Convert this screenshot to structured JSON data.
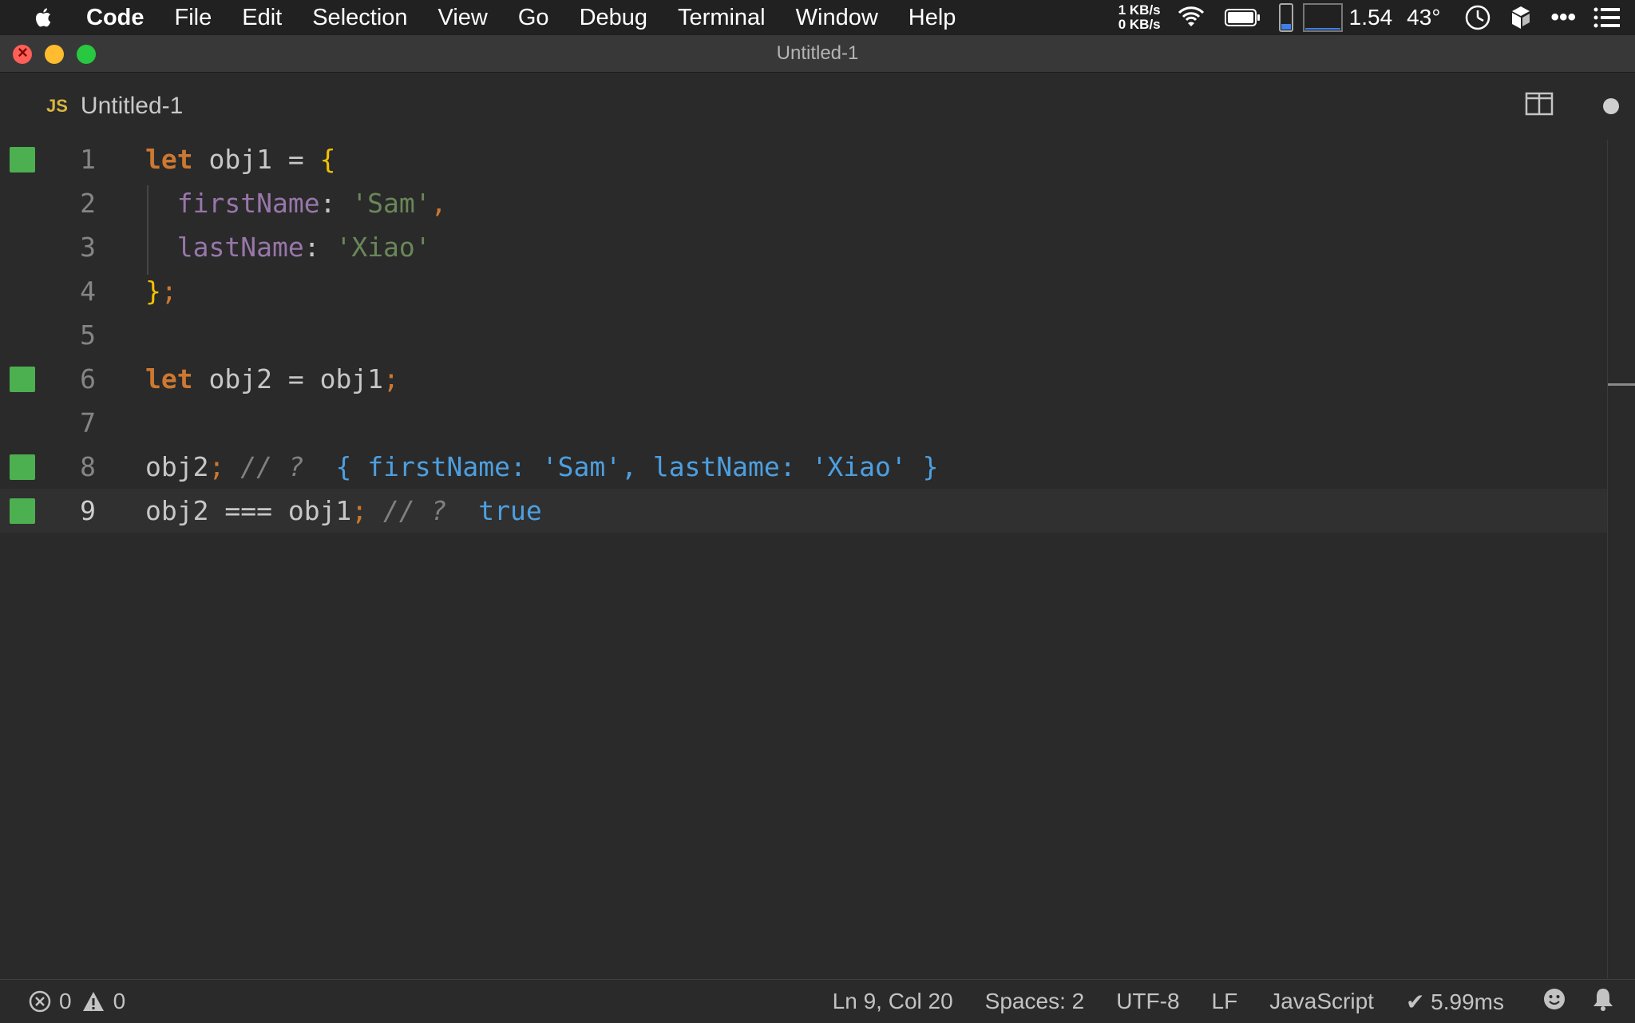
{
  "menubar": {
    "app_name": "Code",
    "items": [
      "File",
      "Edit",
      "Selection",
      "View",
      "Go",
      "Debug",
      "Terminal",
      "Window",
      "Help"
    ],
    "net_up": "1 KB/s",
    "net_down": "0 KB/s",
    "load": "1.54",
    "temp": "43°"
  },
  "window": {
    "title": "Untitled-1"
  },
  "tab": {
    "icon_text": "JS",
    "label": "Untitled-1"
  },
  "editor": {
    "line_numbers": [
      "1",
      "2",
      "3",
      "4",
      "5",
      "6",
      "7",
      "8",
      "9"
    ],
    "current_line": 9,
    "lines": [
      {
        "n": "1",
        "mark": true,
        "tokens": [
          [
            "kw",
            "let"
          ],
          [
            "id",
            " obj1 "
          ],
          [
            "op",
            "="
          ],
          [
            "id",
            " "
          ],
          [
            "brace",
            "{"
          ]
        ]
      },
      {
        "n": "2",
        "mark": false,
        "tokens": [
          [
            "id",
            "  "
          ],
          [
            "prop",
            "firstName"
          ],
          [
            "op",
            ": "
          ],
          [
            "str",
            "'Sam'"
          ],
          [
            "punc",
            ","
          ]
        ]
      },
      {
        "n": "3",
        "mark": false,
        "tokens": [
          [
            "id",
            "  "
          ],
          [
            "prop",
            "lastName"
          ],
          [
            "op",
            ": "
          ],
          [
            "str",
            "'Xiao'"
          ]
        ]
      },
      {
        "n": "4",
        "mark": false,
        "tokens": [
          [
            "brace",
            "}"
          ],
          [
            "punc",
            ";"
          ]
        ]
      },
      {
        "n": "5",
        "mark": false,
        "tokens": []
      },
      {
        "n": "6",
        "mark": true,
        "tokens": [
          [
            "kw",
            "let"
          ],
          [
            "id",
            " obj2 "
          ],
          [
            "op",
            "="
          ],
          [
            "id",
            " obj1"
          ],
          [
            "punc",
            ";"
          ]
        ]
      },
      {
        "n": "7",
        "mark": false,
        "tokens": []
      },
      {
        "n": "8",
        "mark": true,
        "tokens": [
          [
            "id",
            "obj2"
          ],
          [
            "punc",
            ";"
          ],
          [
            "id",
            " "
          ],
          [
            "cmt",
            "// ?"
          ],
          [
            "id",
            "  "
          ],
          [
            "res",
            "{ firstName: 'Sam', lastName: 'Xiao' }"
          ]
        ]
      },
      {
        "n": "9",
        "mark": true,
        "tokens": [
          [
            "id",
            "obj2 "
          ],
          [
            "op",
            "==="
          ],
          [
            "id",
            " obj1"
          ],
          [
            "punc",
            ";"
          ],
          [
            "id",
            " "
          ],
          [
            "cmt",
            "// ?"
          ],
          [
            "id",
            "  "
          ],
          [
            "res",
            "true"
          ]
        ]
      }
    ]
  },
  "statusbar": {
    "errors": "0",
    "warnings": "0",
    "position": "Ln 9, Col 20",
    "spaces": "Spaces: 2",
    "encoding": "UTF-8",
    "eol": "LF",
    "language": "JavaScript",
    "timing": "✔ 5.99ms"
  }
}
